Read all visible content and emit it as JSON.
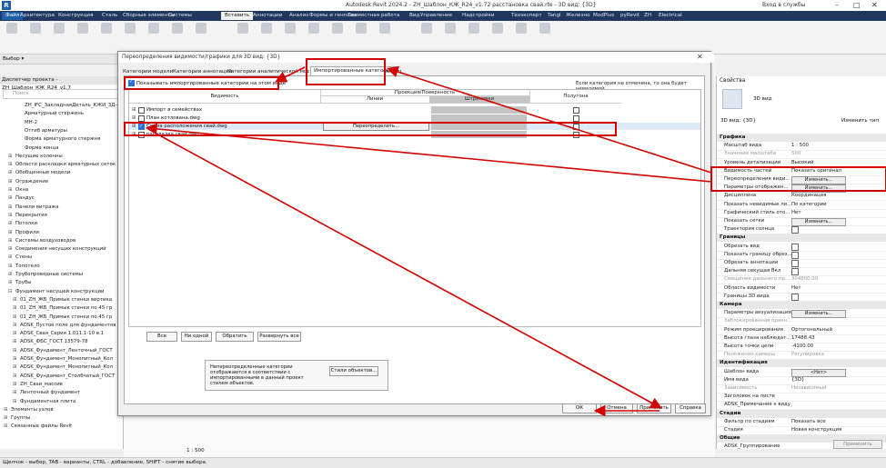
{
  "window": {
    "title": "Autodesk Revit 2024.2 - ZH_Шаблон_КЖ_R24_v1.72 расстановка свай.rte - 3D вид: {3D}",
    "user": "Вход в службы"
  },
  "ribbon_tabs": [
    "Файл",
    "Архитектура",
    "Конструкция",
    "Сталь",
    "Сборные элементы",
    "Системы",
    "Вставить",
    "Аннотации",
    "Анализ",
    "Формы и генплан",
    "Совместная работа",
    "Вид",
    "Управление",
    "Надстройки",
    "Техэксперт",
    "Tangl",
    "Железно",
    "ModPlus",
    "pyRevit",
    "ZH",
    "Electrical"
  ],
  "active_tab": "Вставить",
  "select_label": "Выбор ▾",
  "browser": {
    "title": "Диспетчер проекта - ZH_Шаблон_КЖ_R24_v1.7",
    "search_placeholder": "Поиск",
    "items": [
      "ZH_IFC_ЗакладнаяДеталь_КЖИ_ЗД-4(",
      "Арматурный стержень",
      "МН-2",
      "Отгиб арматуры",
      "Форма арматурного стержня",
      "Форма конца",
      "Несущие колонны",
      "Области раскладки арматурных сеток",
      "Обобщенные модели",
      "Ограждение",
      "Окна",
      "Пандус",
      "Панели витража",
      "Перекрытия",
      "Потолки",
      "Профили",
      "Системы воздуховодов",
      "Соединения несущих конструкций",
      "Стены",
      "Топотело",
      "Трубопроводные системы",
      "Трубы",
      "Фундамент несущей конструкции",
      "01_ZH_ЖБ_Примык стенки вертика",
      "01_ZH_ЖБ_Примык стенки по 45 гр",
      "01_ZH_ЖБ_Примык стенки по 45 гр",
      "ADSK_Пустое поле для фундаментов",
      "ADSK_Свая_Серия 1.011.1-10 в.1",
      "ADSK_ФБС_ГОСТ 13579-78",
      "ADSK_Фундамент_Ленточный_ГОСТ",
      "ADSK_Фундамент_Монолитный_Кол",
      "ADSK_Фундамент_Монолитный_Кол",
      "ADSK_Фундамент_Столбчатый_ГОСТ",
      "ZH_Сваи_массив",
      "Ленточный фундамент",
      "Фундаментная плита",
      "Элементы узлов",
      "Группы",
      "Связанные файлы Revit"
    ]
  },
  "dialog": {
    "title": "Переопределения видимости/графики для 3D вид: {3D}",
    "tabs": [
      "Категории модели",
      "Категории аннотаций",
      "Категории аналитической модели",
      "Импортированные категории",
      "Фильтры"
    ],
    "active_tab": "Импортированные категории",
    "show_checkbox": "Показывать импортированные категории на этом виде",
    "info": "Если категория не отмечена, то она будет невидимой.",
    "headers": {
      "visibility": "Видимость",
      "projection": "Проекция/Поверхность",
      "lines": "Линии",
      "hatch": "Штриховки",
      "halftone": "Полутона"
    },
    "rows": [
      {
        "name": "Импорт в семействах",
        "checked": false
      },
      {
        "name": "План котлована.dwg",
        "checked": false
      },
      {
        "name": "Схема расположения свай.dwg",
        "checked": true
      },
      {
        "name": "раскладка свай.dwg",
        "checked": false
      }
    ],
    "override_button": "Переопределить...",
    "buttons": {
      "all": "Все",
      "none": "Ни одной",
      "invert": "Обратить",
      "expand": "Развернуть все"
    },
    "note": "Непереопределенные категории отображаются в соответствии с импортированными в данный проект стилем объектов.",
    "styles_button": "Стили объектов...",
    "ok": "ОК",
    "cancel": "Отмена",
    "apply": "Применить",
    "help": "Справка"
  },
  "props": {
    "title": "Свойства",
    "type_name": "3D вид",
    "selector": "3D вид: {3D}",
    "edit_type": "Изменить тип",
    "groups": {
      "graphics": "Графика",
      "bounds": "Границы",
      "camera": "Камера",
      "identity": "Идентификация",
      "phase": "Стадии",
      "general": "Общие"
    },
    "rows": {
      "scale": [
        "Масштаб вида",
        "1 : 500"
      ],
      "scale_value": [
        "Значение масштаба",
        "500"
      ],
      "detail": [
        "Уровень детализации",
        "Высокий"
      ],
      "parts": [
        "Видимость частей",
        "Показать оригинал"
      ],
      "vg": [
        "Переопределения види...",
        "Изменить..."
      ],
      "display": [
        "Параметры отображен...",
        "Изменить..."
      ],
      "discipline": [
        "Дисциплина",
        "Координация"
      ],
      "hidden": [
        "Показать невидимые ли...",
        "По категории"
      ],
      "style": [
        "Графический стиль ото...",
        "Нет"
      ],
      "grid": [
        "Показать сетки",
        "Изменить..."
      ],
      "sun": [
        "Траектория солнца",
        ""
      ],
      "crop": [
        "Обрезать вид",
        ""
      ],
      "crop_show": [
        "Показать границу обрез...",
        ""
      ],
      "ann_crop": [
        "Обрезать аннотации",
        ""
      ],
      "far": [
        "Дальняя секущая Вкл",
        ""
      ],
      "far_off": [
        "Смещение дальнего пр...",
        "304800.00"
      ],
      "scope": [
        "Область видимости",
        "Нет"
      ],
      "box": [
        "Границы 3D вида",
        ""
      ],
      "render": [
        "Параметры визуализации",
        "Изменить..."
      ],
      "locked": [
        "Заблокированная ориен...",
        ""
      ],
      "proj": [
        "Режим проецирования",
        "Ортогональный"
      ],
      "eye": [
        "Высота глаза наблюдат...",
        "17488.43"
      ],
      "target": [
        "Высота точки цели",
        "-4100.00"
      ],
      "cam_pos": [
        "Положение камеры",
        "Регулировка"
      ],
      "template": [
        "Шаблон вида",
        "<Нет>"
      ],
      "viewname": [
        "Имя вида",
        "{3D}"
      ],
      "depend": [
        "Зависимость",
        "Независимый"
      ],
      "sheet_title": [
        "Заголовок на листе",
        ""
      ],
      "adsk_note": [
        "ADSK_Примечание к виду",
        ""
      ],
      "phase_filter": [
        "Фильтр по стадиям",
        "Показать все"
      ],
      "phase": [
        "Стадия",
        "Новая конструкция"
      ],
      "grouping": [
        "ADSK_Группирование",
        ""
      ]
    },
    "apply": "Применить"
  },
  "status": {
    "text": "Щелчок - выбор, TAB - варианты, CTRL - добавление, SHIFT - снятие выбора.",
    "scale": "1 : 500"
  }
}
